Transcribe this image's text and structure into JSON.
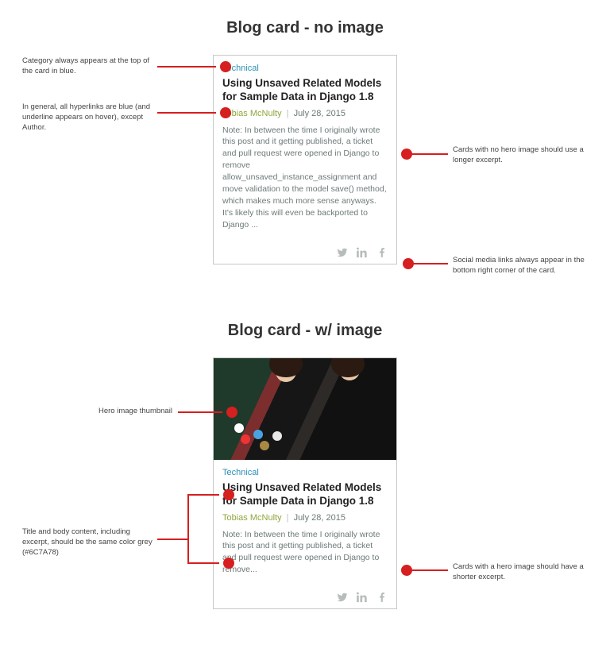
{
  "headings": {
    "no_image": "Blog card - no image",
    "with_image": "Blog card - w/ image"
  },
  "card": {
    "category": "Technical",
    "title": "Using Unsaved Related Models for Sample Data in Django 1.8",
    "author": "Tobias McNulty",
    "date": "July 28, 2015",
    "excerpt_long": "Note: In between the time I originally wrote this post and it getting published, a ticket and pull request were opened in Django to remove allow_unsaved_instance_assignment and move validation to the model save() method, which makes much more sense anyways. It's likely this will even be backported to Django ...",
    "excerpt_short": "Note: In between the time I originally wrote this post and it getting published, a ticket and pull request were opened in Django to remove..."
  },
  "annotations": {
    "a1": "Category always appears at the top of the card in blue.",
    "a2": "In general, all hyperlinks are blue (and underline appears on hover), except Author.",
    "a3": "Cards with no hero image should use a longer excerpt.",
    "a4": "Social media links always appear in the bottom right corner of the card.",
    "b1": "Hero image thumbnail",
    "b2": "Title and body content, including excerpt, should be the same color grey (#6C7A78)",
    "b3": "Cards with a hero image should have a shorter excerpt."
  }
}
